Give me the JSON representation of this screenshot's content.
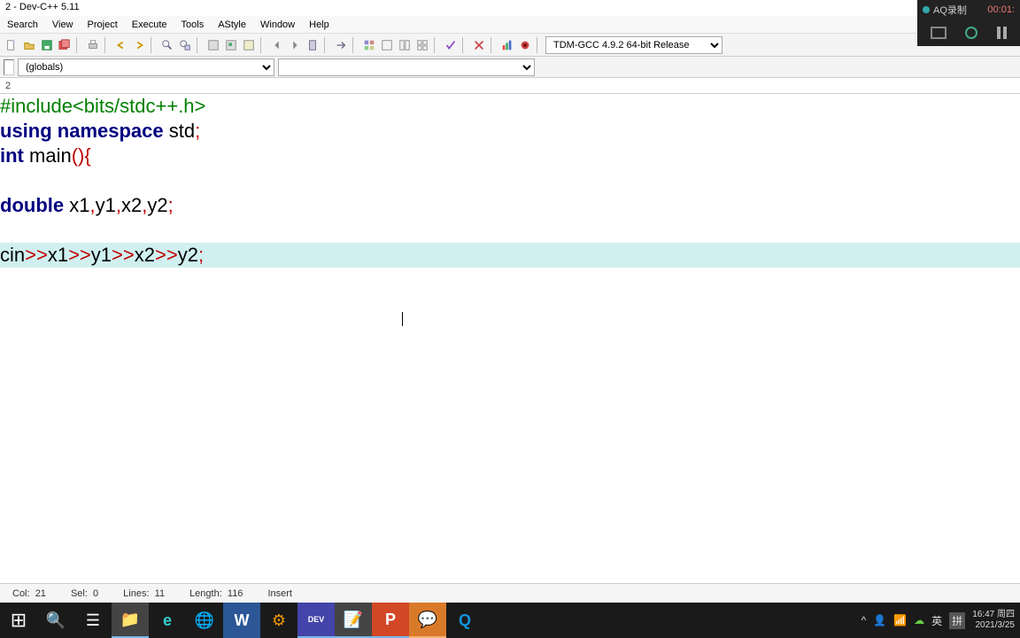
{
  "title": "2 - Dev-C++ 5.11",
  "menus": [
    "Search",
    "View",
    "Project",
    "Execute",
    "Tools",
    "AStyle",
    "Window",
    "Help"
  ],
  "compiler": "TDM-GCC 4.9.2 64-bit Release",
  "globals": "(globals)",
  "tab_label": "2",
  "code": {
    "l1a": "#include",
    "l1b": "<bits/stdc++.h>",
    "l2a": "using",
    "l2b": " namespace ",
    "l2c": "std",
    "l2d": ";",
    "l3a": "int",
    "l3b": " main",
    "l3c": "(){",
    "l4": "",
    "l5a": "double",
    "l5b": " x1",
    "l5c": ",",
    "l5d": "y1",
    "l5e": ",",
    "l5f": "x2",
    "l5g": ",",
    "l5h": "y2",
    "l5i": ";",
    "l6": "",
    "l7a": "cin",
    "l7b": ">>",
    "l7c": "x1",
    "l7d": ">>",
    "l7e": "y1",
    "l7f": ">>",
    "l7g": "x2",
    "l7h": ">>",
    "l7i": "y2",
    "l7j": ";"
  },
  "status": {
    "col_label": "Col:",
    "col": "21",
    "sel_label": "Sel:",
    "sel": "0",
    "lines_label": "Lines:",
    "lines": "11",
    "length_label": "Length:",
    "length": "116",
    "mode": "Insert"
  },
  "recorder": {
    "name": "AQ录制",
    "time": "00:01:"
  },
  "tray": {
    "ime1": "英",
    "ime2": "拼",
    "time": "16:47 周四",
    "date": "2021/3/25"
  },
  "icons": {
    "win": "⊞",
    "search": "🔍",
    "task": "☰",
    "folder": "📁",
    "edge": "e",
    "browser": "🌐",
    "word": "W",
    "settings": "⚙",
    "dev": "DEV",
    "note": "📝",
    "ppt": "P",
    "wechat": "💬",
    "qq": "Q",
    "up": "^",
    "user": "👤",
    "wifi": "📶",
    "cloud": "☁"
  }
}
